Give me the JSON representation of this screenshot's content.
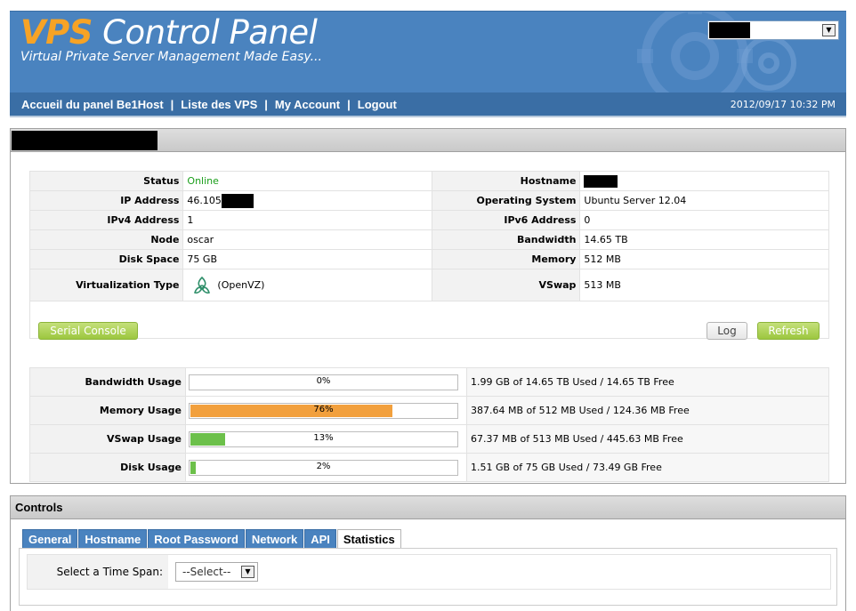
{
  "header": {
    "logo_accent": "VPS",
    "logo_rest": " Control Panel",
    "tagline": "Virtual Private Server Management Made Easy...",
    "datetime": "2012/09/17 10:32 PM"
  },
  "nav": {
    "items": [
      "Accueil du panel Be1Host",
      "Liste des VPS",
      "My Account",
      "Logout"
    ],
    "separator": "|"
  },
  "info": {
    "status_label": "Status",
    "status_value": "Online",
    "hostname_label": "Hostname",
    "ip_label": "IP Address",
    "ip_value": "46.105",
    "os_label": "Operating System",
    "os_value": "Ubuntu Server 12.04",
    "ipv4_label": "IPv4 Address",
    "ipv4_value": "1",
    "ipv6_label": "IPv6 Address",
    "ipv6_value": "0",
    "node_label": "Node",
    "node_value": "oscar",
    "bandwidth_label": "Bandwidth",
    "bandwidth_value": "14.65 TB",
    "disk_label": "Disk Space",
    "disk_value": "75 GB",
    "memory_label": "Memory",
    "memory_value": "512 MB",
    "virt_label": "Virtualization Type",
    "virt_value": "(OpenVZ)",
    "vswap_label": "VSwap",
    "vswap_value": "513 MB"
  },
  "buttons": {
    "serial_console": "Serial Console",
    "log": "Log",
    "refresh": "Refresh"
  },
  "usage": [
    {
      "label": "Bandwidth Usage",
      "percent_text": "0%",
      "percent": 0,
      "color": "#6cc04a",
      "detail": "1.99 GB of 14.65 TB Used / 14.65 TB Free"
    },
    {
      "label": "Memory Usage",
      "percent_text": "76%",
      "percent": 76,
      "color": "#f2a03d",
      "detail": "387.64 MB of 512 MB Used / 124.36 MB Free"
    },
    {
      "label": "VSwap Usage",
      "percent_text": "13%",
      "percent": 13,
      "color": "#6cc04a",
      "detail": "67.37 MB of 513 MB Used / 445.63 MB Free"
    },
    {
      "label": "Disk Usage",
      "percent_text": "2%",
      "percent": 2,
      "color": "#6cc04a",
      "detail": "1.51 GB of 75 GB Used / 73.49 GB Free"
    }
  ],
  "controls": {
    "title": "Controls",
    "tabs": [
      "General",
      "Hostname",
      "Root Password",
      "Network",
      "API",
      "Statistics"
    ],
    "active_tab": "Statistics",
    "time_span_label": "Select a Time Span:",
    "time_span_value": "--Select--"
  },
  "colors": {
    "header_blue": "#4a83bf",
    "accent_orange": "#f7a325",
    "online_green": "#1a9e1a",
    "button_green": "#9cc73f"
  }
}
